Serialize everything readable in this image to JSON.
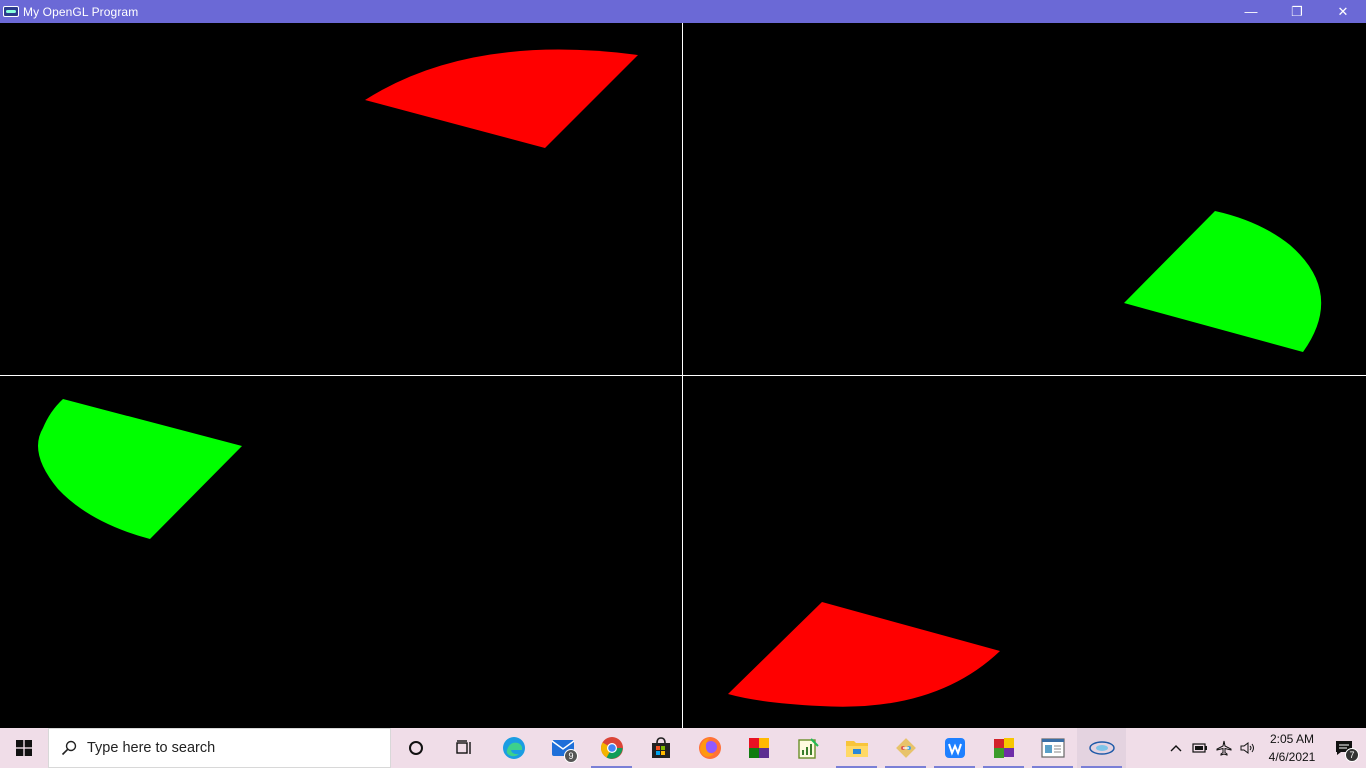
{
  "window": {
    "title": "My OpenGL Program",
    "controls": {
      "minimize": "—",
      "restore": "❐",
      "close": "✕"
    }
  },
  "viewports": [
    {
      "name": "top-left",
      "shape": "sector",
      "color": "#ff0000"
    },
    {
      "name": "top-right",
      "shape": "sector",
      "color": "#00ff00"
    },
    {
      "name": "bottom-left",
      "shape": "sector",
      "color": "#00ff00"
    },
    {
      "name": "bottom-right",
      "shape": "sector",
      "color": "#ff0000"
    }
  ],
  "colors": {
    "red": "#ff0000",
    "green": "#00ff00",
    "divider": "#ffffff",
    "titlebar": "#6b69d6",
    "taskbar": "#f0dde8"
  },
  "taskbar": {
    "search_placeholder": "Type here to search",
    "apps": [
      {
        "name": "cortana-icon"
      },
      {
        "name": "task-view-icon"
      },
      {
        "name": "edge-icon"
      },
      {
        "name": "mail-icon",
        "badge": "9"
      },
      {
        "name": "chrome-icon",
        "active": true
      },
      {
        "name": "store-icon"
      },
      {
        "name": "firefox-icon"
      },
      {
        "name": "app-colorful-icon"
      },
      {
        "name": "notepad-chart-icon"
      },
      {
        "name": "file-explorer-icon",
        "active": true
      },
      {
        "name": "git-icon",
        "active": true
      },
      {
        "name": "wps-icon",
        "active": true
      },
      {
        "name": "app-windows-tiles-icon",
        "active": true
      },
      {
        "name": "app-window-icon",
        "active": true
      },
      {
        "name": "opengl-icon",
        "active": true
      }
    ],
    "tray": {
      "time": "2:05 AM",
      "date": "4/6/2021",
      "notification_count": "7"
    }
  }
}
